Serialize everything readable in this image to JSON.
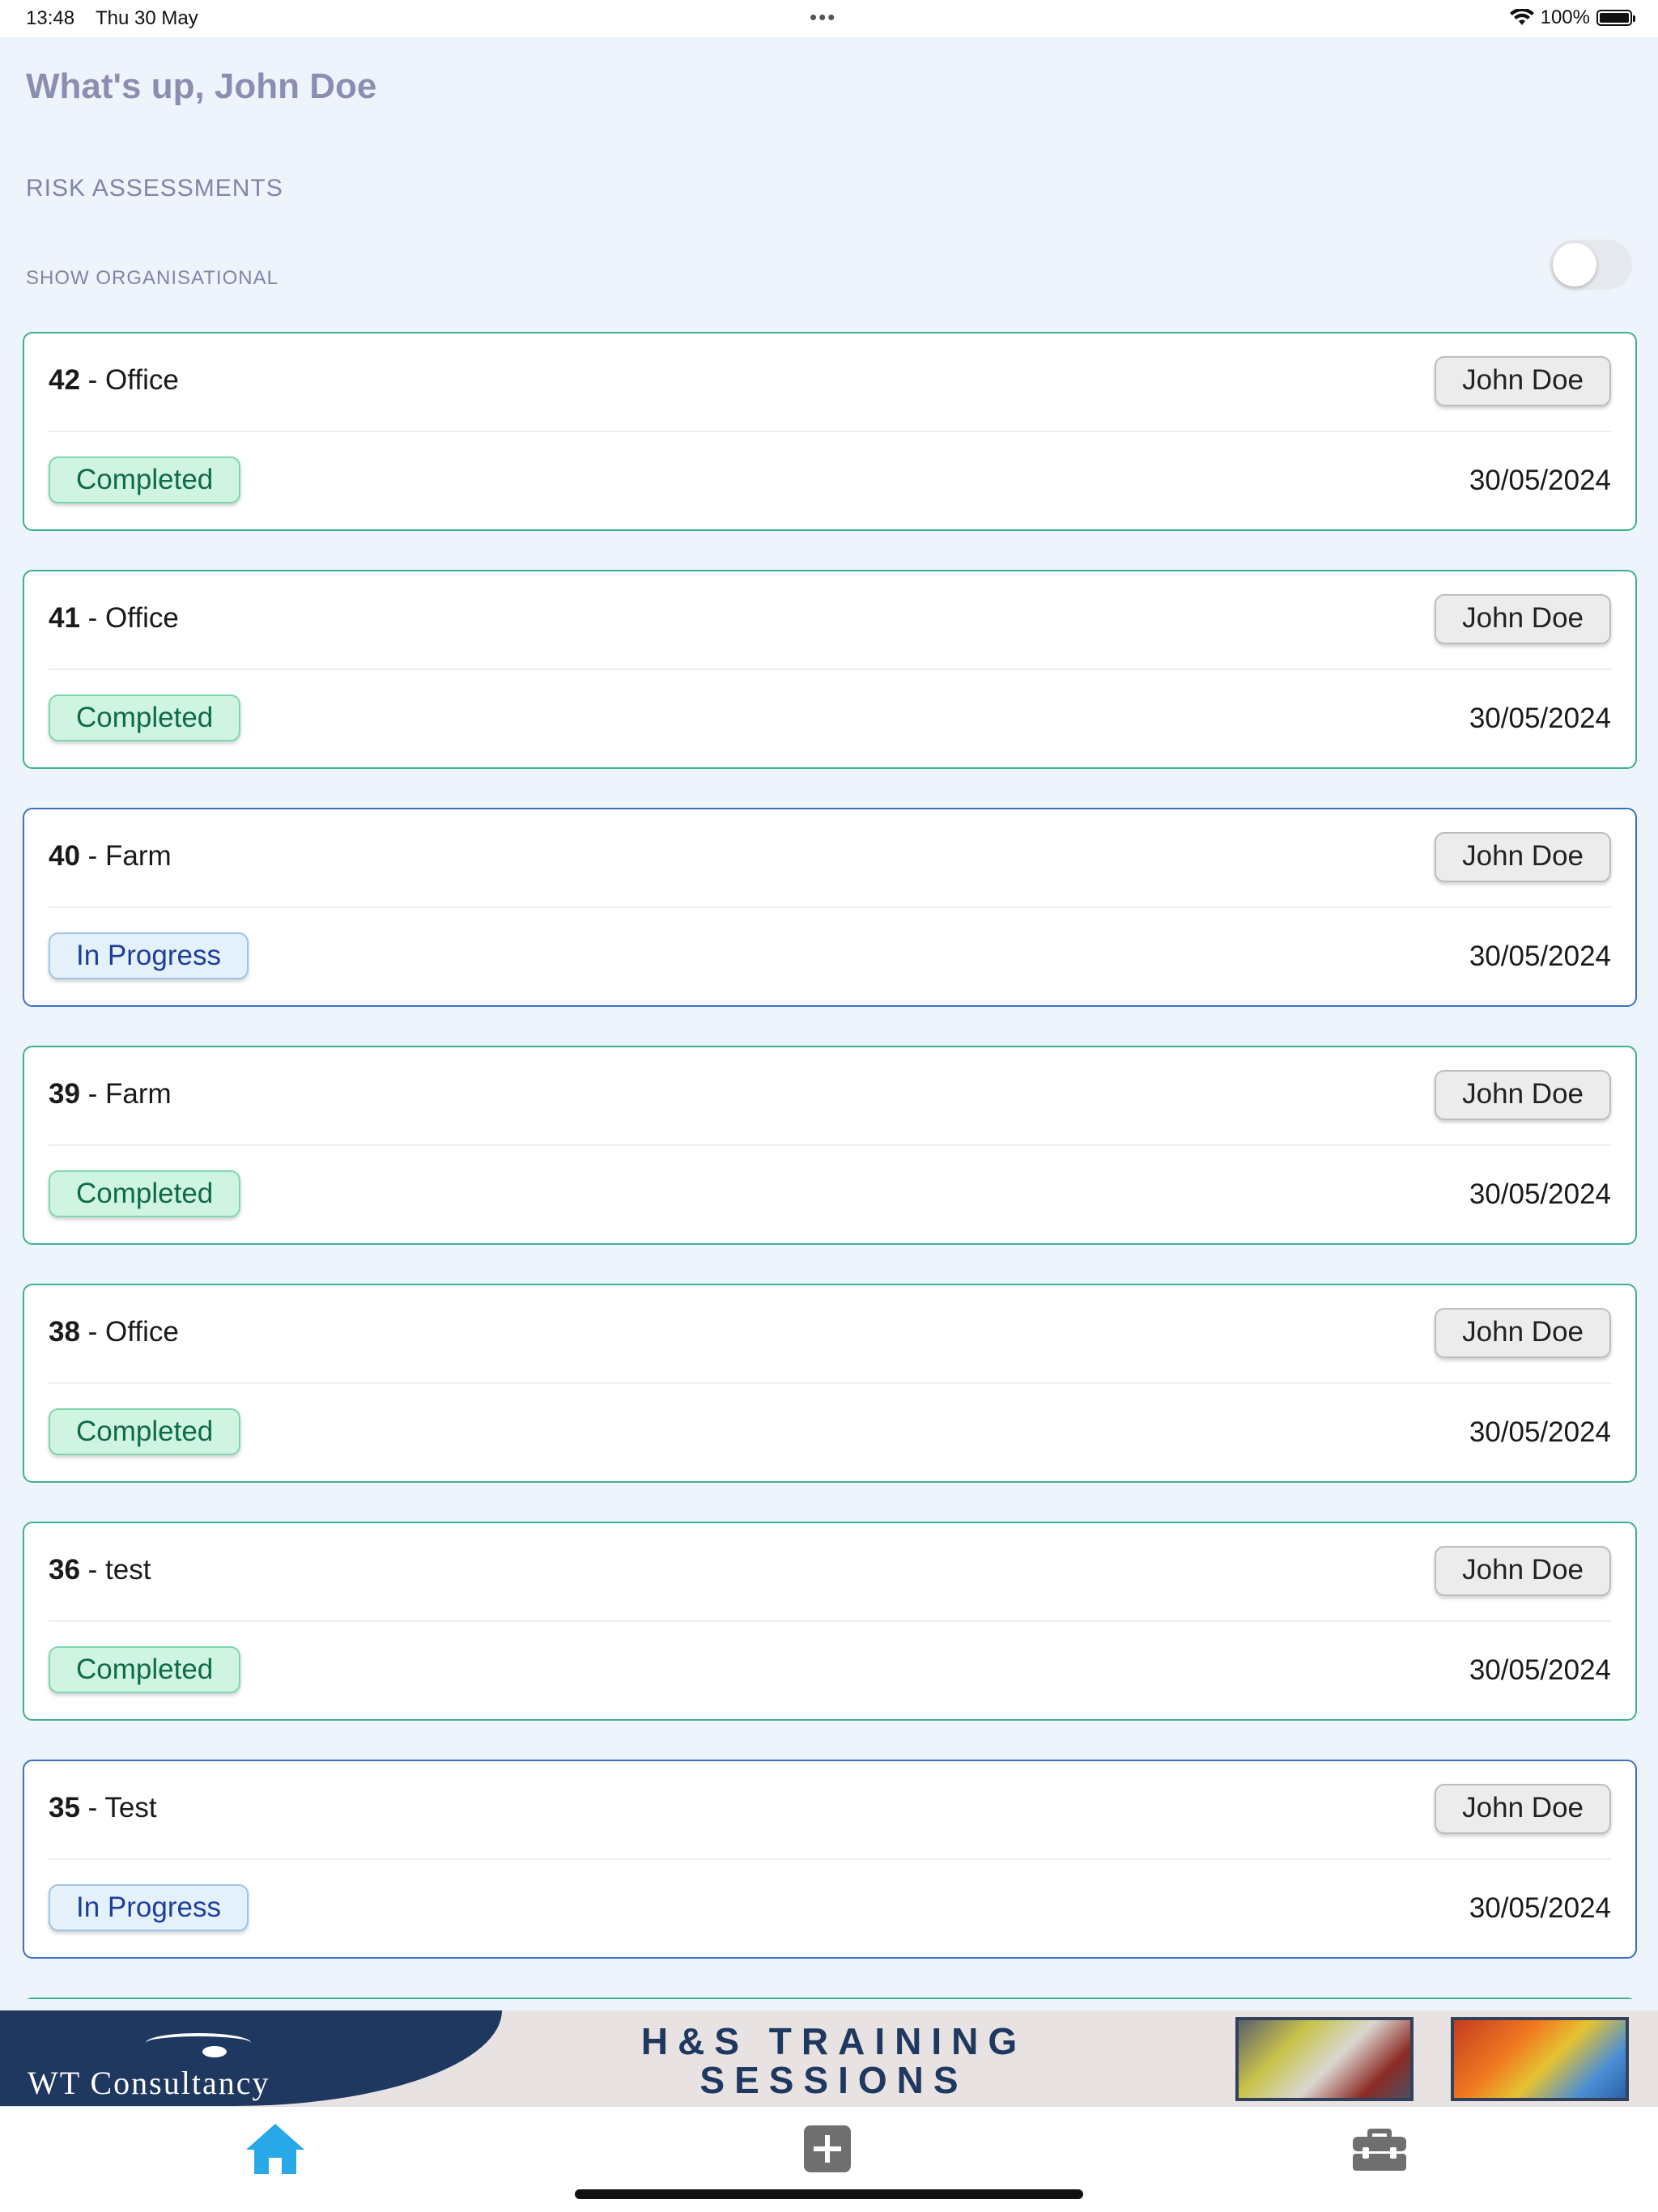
{
  "status_bar": {
    "time": "13:48",
    "date": "Thu 30 May",
    "dots": "•••",
    "battery": "100%"
  },
  "header": {
    "greeting": "What's up, John Doe"
  },
  "section": {
    "title": "RISK ASSESSMENTS",
    "org_toggle_label": "SHOW ORGANISATIONAL",
    "org_toggle_on": false
  },
  "cards": [
    {
      "num": "42",
      "name": " - Office",
      "owner": "John Doe",
      "status": "Completed",
      "date": "30/05/2024"
    },
    {
      "num": "41",
      "name": " - Office",
      "owner": "John Doe",
      "status": "Completed",
      "date": "30/05/2024"
    },
    {
      "num": "40",
      "name": " - Farm",
      "owner": "John Doe",
      "status": "In Progress",
      "date": "30/05/2024"
    },
    {
      "num": "39",
      "name": " - Farm",
      "owner": "John Doe",
      "status": "Completed",
      "date": "30/05/2024"
    },
    {
      "num": "38",
      "name": " - Office",
      "owner": "John Doe",
      "status": "Completed",
      "date": "30/05/2024"
    },
    {
      "num": "36",
      "name": " - test",
      "owner": "John Doe",
      "status": "Completed",
      "date": "30/05/2024"
    },
    {
      "num": "35",
      "name": " - Test",
      "owner": "John Doe",
      "status": "In Progress",
      "date": "30/05/2024"
    }
  ],
  "banner": {
    "logo_text": "WT Consultancy",
    "title_line1": "H&S TRAINING",
    "title_line2": "SESSIONS"
  },
  "tabbar": {
    "tabs": [
      "home-icon",
      "add-icon",
      "toolbox-icon"
    ],
    "active_color": "#29a8e8",
    "inactive_color": "#6f6f6f"
  },
  "colors": {
    "completed_border": "#3db28a",
    "in_progress_border": "#3a6fc4",
    "background": "#eef4fc"
  }
}
